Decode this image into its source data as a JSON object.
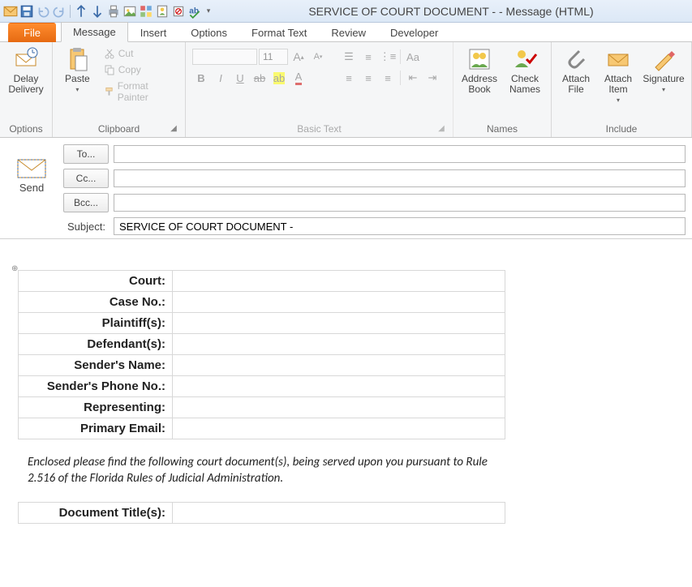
{
  "window": {
    "title": "SERVICE OF COURT DOCUMENT -  - Message (HTML)"
  },
  "tabs": {
    "file": "File",
    "message": "Message",
    "insert": "Insert",
    "options": "Options",
    "format_text": "Format Text",
    "review": "Review",
    "developer": "Developer"
  },
  "ribbon": {
    "options": {
      "delay_delivery": "Delay\nDelivery",
      "group": "Options"
    },
    "clipboard": {
      "paste": "Paste",
      "cut": "Cut",
      "copy": "Copy",
      "format_painter": "Format Painter",
      "group": "Clipboard"
    },
    "basic_text": {
      "font_size": "11",
      "group": "Basic Text"
    },
    "names": {
      "address_book": "Address\nBook",
      "check_names": "Check\nNames",
      "group": "Names"
    },
    "include": {
      "attach_file": "Attach\nFile",
      "attach_item": "Attach\nItem",
      "signature": "Signature",
      "group": "Include"
    }
  },
  "header": {
    "send": "Send",
    "to": "To...",
    "cc": "Cc...",
    "bcc": "Bcc...",
    "subject_label": "Subject:",
    "subject_value": "SERVICE OF COURT DOCUMENT - "
  },
  "body": {
    "rows": [
      "Court:",
      "Case No.:",
      "Plaintiff(s):",
      "Defendant(s):",
      "Sender's Name:",
      "Sender's Phone No.:",
      "Representing:",
      "Primary Email:"
    ],
    "paragraph": "Enclosed please find  the following court document(s), being served upon you pursuant to Rule 2.516 of the Florida Rules of Judicial Administration.",
    "doc_titles": "Document Title(s):"
  }
}
